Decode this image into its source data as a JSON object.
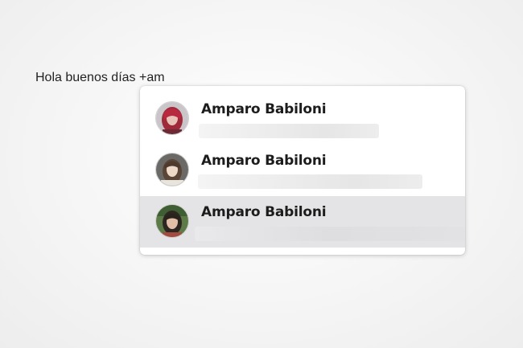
{
  "composer": {
    "text": "Hola buenos días +am"
  },
  "mention_popup": {
    "suggestions": [
      {
        "name": "Amparo Babiloni",
        "avatar_icon": "user-avatar-red-hair-icon",
        "highlighted": false
      },
      {
        "name": "Amparo Babiloni",
        "avatar_icon": "user-avatar-brown-hair-icon",
        "highlighted": false
      },
      {
        "name": "Amparo Babiloni",
        "avatar_icon": "user-avatar-dark-hair-outdoor-icon",
        "highlighted": true
      }
    ],
    "highlight_color": "#e4e4e6"
  }
}
